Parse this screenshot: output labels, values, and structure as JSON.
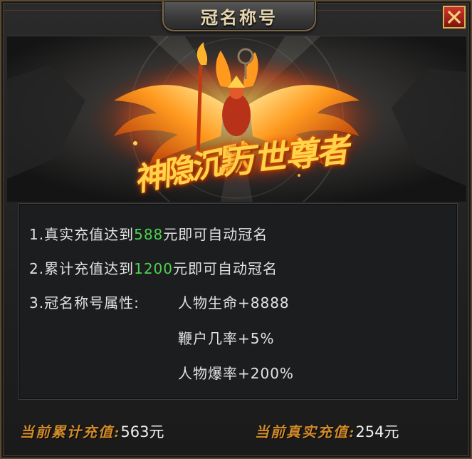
{
  "window": {
    "title": "冠名称号"
  },
  "banner": {
    "text_left": "神隐沉默",
    "text_right": "万世尊者"
  },
  "rules": [
    {
      "prefix": "1.真实充值达到",
      "amount": "588",
      "suffix": "元即可自动冠名"
    },
    {
      "prefix": "2.累计充值达到",
      "amount": "1200",
      "suffix": "元即可自动冠名"
    }
  ],
  "attributes": {
    "label": "3.冠名称号属性:",
    "items": [
      "人物生命+8888",
      "鞭户几率+5%",
      "人物爆率+200%"
    ]
  },
  "footer": {
    "cumulative_label": "当前累计充值:",
    "cumulative_value": "563元",
    "real_label": "当前真实充值:",
    "real_value": "254元"
  },
  "colors": {
    "highlight": "#4fd24f",
    "footer_label": "#d08a2a",
    "close_button": "#c0281f"
  },
  "icons": {
    "close": "close-x-icon"
  }
}
